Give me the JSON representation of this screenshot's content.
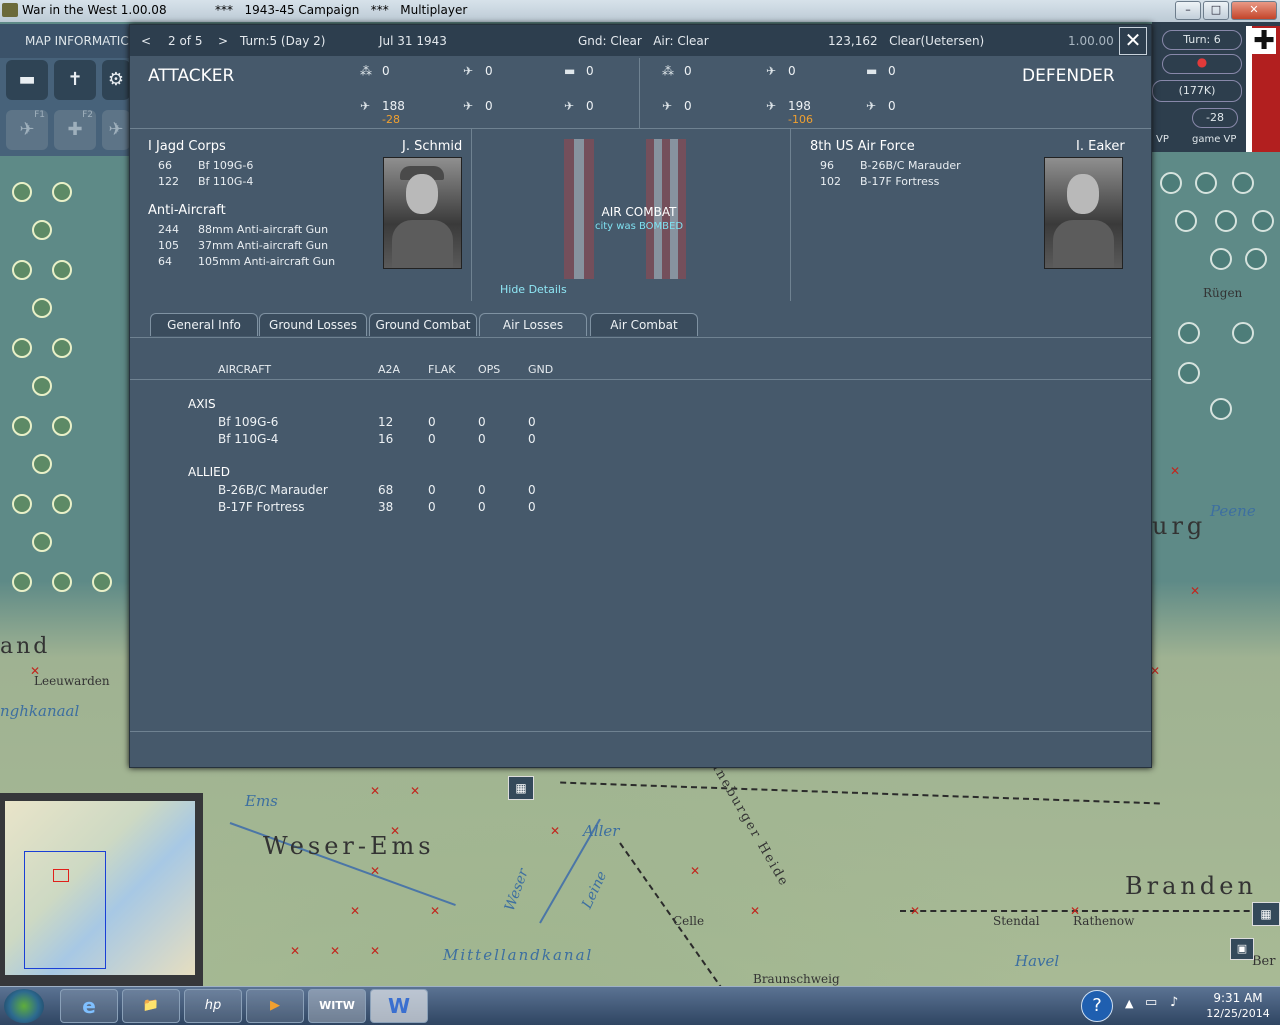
{
  "window": {
    "title": "War in the West 1.00.08",
    "subtitle": "***   1943-45 Campaign   ***   Multiplayer",
    "controls": [
      "–",
      "□",
      "✕"
    ]
  },
  "map_panel": {
    "label": "MAP INFORMATIC",
    "tools_row1": [
      "tank-icon",
      "units-icon",
      "gear-icon"
    ],
    "tools_row2": [
      {
        "icon": "air-icon",
        "key": "F1"
      },
      {
        "icon": "ground-air-icon",
        "key": "F2"
      },
      {
        "icon": "plane-icon",
        "key": ""
      }
    ]
  },
  "right_panel": {
    "turn": "Turn: 6",
    "value": "(177K)",
    "vp_change": "-28",
    "vp_label": "VP",
    "game_vp_label": "game VP"
  },
  "map_labels": {
    "leeuwarden": "Leeuwarden",
    "kanaal": "nghkanaal",
    "ems": "Ems",
    "weser_ems": "Weser-Ems",
    "aller": "Aller",
    "weser": "Weser",
    "leine": "Leine",
    "heide": "Lüneburger Heide",
    "celle": "Celle",
    "stendal": "Stendal",
    "rathenow": "Rathenow",
    "havel": "Havel",
    "braunschweig": "Braunschweig",
    "mittellandkanal": "Mittellandkanal",
    "branden": "Branden",
    "peene": "Peene",
    "rugen": "Rügen",
    "urg": "urg",
    "and": "and",
    "ber": "Ber"
  },
  "dialog": {
    "header": {
      "prev": "<",
      "page": "2 of 5",
      "next": ">",
      "turn": "Turn:5 (Day 2)",
      "date": "Jul 31 1943",
      "weather": "Gnd: Clear   Air: Clear",
      "location": "123,162   Clear(Uetersen)",
      "version": "1.00.00"
    },
    "attacker": {
      "title": "ATTACKER",
      "units": [
        {
          "icon": "infantry-icon",
          "value": "0",
          "loss": ""
        },
        {
          "icon": "fighter-icon",
          "value": "0",
          "loss": ""
        },
        {
          "icon": "tank-icon",
          "value": "0",
          "loss": ""
        },
        {
          "icon": "fighter-plane-icon",
          "value": "188",
          "loss": "-28"
        },
        {
          "icon": "bomber-icon",
          "value": "0",
          "loss": ""
        },
        {
          "icon": "recon-plane-icon",
          "value": "0",
          "loss": ""
        }
      ]
    },
    "defender": {
      "title": "DEFENDER",
      "units": [
        {
          "icon": "infantry-icon",
          "value": "0",
          "loss": ""
        },
        {
          "icon": "fighter-icon",
          "value": "0",
          "loss": ""
        },
        {
          "icon": "tank-icon",
          "value": "0",
          "loss": ""
        },
        {
          "icon": "fighter-plane-icon",
          "value": "0",
          "loss": ""
        },
        {
          "icon": "bomber-icon",
          "value": "198",
          "loss": "-106"
        },
        {
          "icon": "recon-plane-icon",
          "value": "0",
          "loss": ""
        }
      ]
    },
    "details": {
      "attacker_unit": "I Jagd Corps",
      "attacker_commander": "J. Schmid",
      "attacker_aircraft": [
        {
          "qty": "66",
          "name": "Bf 109G-6"
        },
        {
          "qty": "122",
          "name": "Bf 110G-4"
        }
      ],
      "aa_title": "Anti-Aircraft",
      "aa": [
        {
          "qty": "244",
          "name": "88mm Anti-aircraft Gun"
        },
        {
          "qty": "105",
          "name": "37mm Anti-aircraft Gun"
        },
        {
          "qty": "64",
          "name": "105mm Anti-aircraft Gun"
        }
      ],
      "combat_type": "AIR COMBAT",
      "combat_result": "city was BOMBED",
      "hide_details": "Hide Details",
      "defender_unit": "8th US Air Force",
      "defender_commander": "I. Eaker",
      "defender_aircraft": [
        {
          "qty": "96",
          "name": "B-26B/C Marauder"
        },
        {
          "qty": "102",
          "name": "B-17F Fortress"
        }
      ]
    },
    "tabs": [
      "General Info",
      "Ground Losses",
      "Ground Combat",
      "Air Losses",
      "Air Combat"
    ],
    "active_tab": "Air Losses",
    "table": {
      "columns": [
        "AIRCRAFT",
        "A2A",
        "FLAK",
        "OPS",
        "GND"
      ],
      "groups": [
        {
          "name": "AXIS",
          "rows": [
            {
              "aircraft": "Bf 109G-6",
              "a2a": "12",
              "flak": "0",
              "ops": "0",
              "gnd": "0"
            },
            {
              "aircraft": "Bf 110G-4",
              "a2a": "16",
              "flak": "0",
              "ops": "0",
              "gnd": "0"
            }
          ]
        },
        {
          "name": "ALLIED",
          "rows": [
            {
              "aircraft": "B-26B/C Marauder",
              "a2a": "68",
              "flak": "0",
              "ops": "0",
              "gnd": "0"
            },
            {
              "aircraft": "B-17F Fortress",
              "a2a": "38",
              "flak": "0",
              "ops": "0",
              "gnd": "0"
            }
          ]
        }
      ]
    }
  },
  "taskbar": {
    "apps": [
      "e",
      "📁",
      "hp",
      "▶",
      "WITW",
      "W"
    ],
    "help": "?",
    "time": "9:31 AM",
    "date": "12/25/2014"
  }
}
